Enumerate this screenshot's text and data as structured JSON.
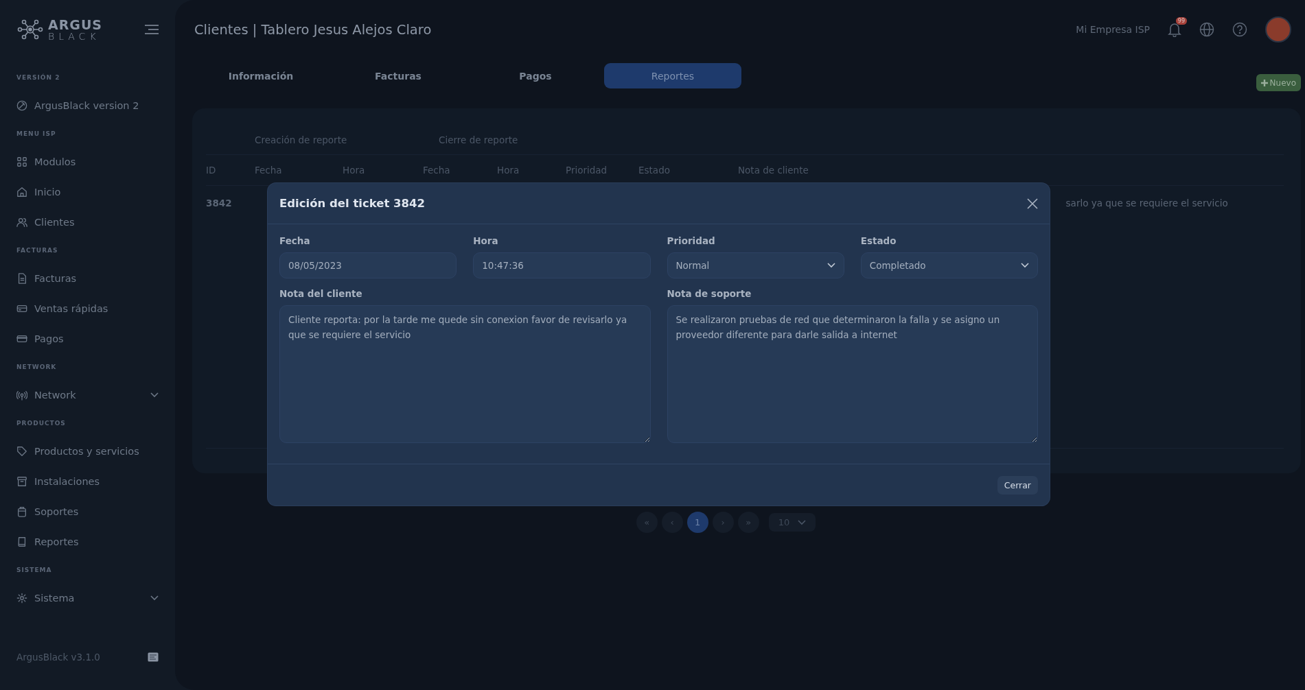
{
  "sidebar": {
    "logo": {
      "top": "ARGUS",
      "bottom": "BLACK"
    },
    "sections": [
      {
        "title": "VERSIÓN 2",
        "items": [
          {
            "label": "ArgusBlack version 2",
            "kind": "link"
          }
        ]
      },
      {
        "title": "MENU ISP",
        "items": [
          {
            "label": "Modulos",
            "kind": "link"
          },
          {
            "label": "Inicio",
            "kind": "link"
          },
          {
            "label": "Clientes",
            "kind": "link"
          }
        ]
      },
      {
        "title": "FACTURAS",
        "items": [
          {
            "label": "Facturas",
            "kind": "link"
          },
          {
            "label": "Ventas rápidas",
            "kind": "link"
          },
          {
            "label": "Pagos",
            "kind": "link"
          }
        ]
      },
      {
        "title": "NETWORK",
        "items": [
          {
            "label": "Network",
            "kind": "dropdown"
          }
        ]
      },
      {
        "title": "PRODUCTOS",
        "items": [
          {
            "label": "Productos y servicios",
            "kind": "link"
          },
          {
            "label": "Instalaciones",
            "kind": "link"
          },
          {
            "label": "Soportes",
            "kind": "link"
          },
          {
            "label": "Reportes",
            "kind": "link"
          }
        ]
      },
      {
        "title": "SISTEMA",
        "items": [
          {
            "label": "Sistema",
            "kind": "dropdown"
          }
        ]
      }
    ],
    "footer": "ArgusBlack v3.1.0"
  },
  "header": {
    "title": "Clientes | Tablero Jesus Alejos Claro",
    "company": "Mi Empresa ISP",
    "notifications": "99"
  },
  "tabs": [
    {
      "label": "Información",
      "selected": false
    },
    {
      "label": "Facturas",
      "selected": false
    },
    {
      "label": "Pagos",
      "selected": false
    },
    {
      "label": "Reportes",
      "selected": true
    }
  ],
  "new_button": "Nuevo",
  "table": {
    "column_groups": [
      "Creación de reporte",
      "Cierre de reporte"
    ],
    "columns": [
      "ID",
      "Fecha",
      "Hora",
      "Fecha",
      "Hora",
      "Prioridad",
      "Estado",
      "Nota de cliente"
    ],
    "rows": [
      {
        "id": "3842",
        "note_tail": "sarlo ya que se requiere el servicio"
      }
    ]
  },
  "pagination": {
    "buttons": [
      {
        "label": "«",
        "selected": false
      },
      {
        "label": "‹",
        "selected": false
      },
      {
        "label": "1",
        "selected": true
      },
      {
        "label": "›",
        "selected": false
      },
      {
        "label": "»",
        "selected": false
      }
    ],
    "page_size": "10"
  },
  "modal": {
    "title": "Edición del ticket 3842",
    "fields": [
      {
        "label": "Fecha",
        "value": "08/05/2023",
        "kind": "input"
      },
      {
        "label": "Hora",
        "value": "10:47:36",
        "kind": "input"
      },
      {
        "label": "Prioridad",
        "value": "Normal",
        "kind": "select"
      },
      {
        "label": "Estado",
        "value": "Completado",
        "kind": "select"
      }
    ],
    "notes": [
      {
        "label": "Nota del cliente",
        "value": "Cliente reporta: por la tarde me quede sin conexion favor de revisarlo ya que se requiere el servicio"
      },
      {
        "label": "Nota de soporte",
        "value": "Se realizaron pruebas de red que determinaron la falla y se asigno un proveedor diferente para darle salida a internet"
      }
    ],
    "close_button": "Cerrar"
  }
}
